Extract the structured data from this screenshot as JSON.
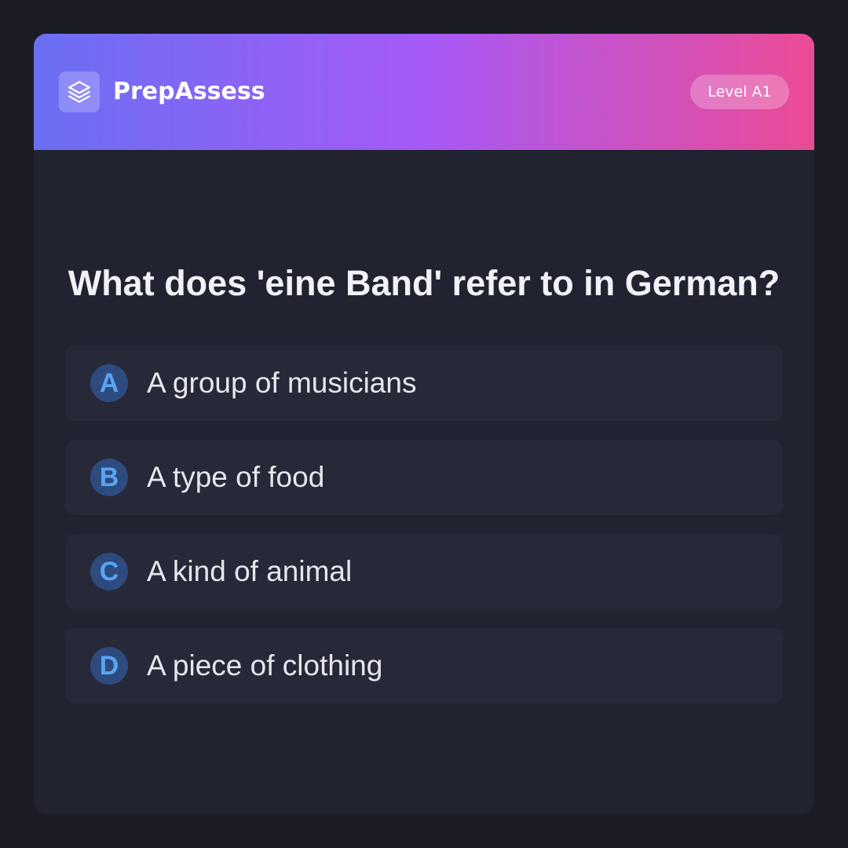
{
  "header": {
    "logo_icon": "layers-icon",
    "brand": "PrepAssess",
    "level_badge": "Level A1",
    "gradient": [
      "#6a6ff3",
      "#a659f7",
      "#ec4b95"
    ]
  },
  "quiz": {
    "question": "What does 'eine Band' refer to in German?",
    "options": [
      {
        "letter": "A",
        "text": "A group of musicians"
      },
      {
        "letter": "B",
        "text": "A type of food"
      },
      {
        "letter": "C",
        "text": "A kind of animal"
      },
      {
        "letter": "D",
        "text": "A piece of clothing"
      }
    ]
  },
  "colors": {
    "page_background": "#1b1c26",
    "card_background": "#212330",
    "option_background": "#272938",
    "letter_circle": "#2d4b7f",
    "letter_text": "#5aa4f3"
  }
}
